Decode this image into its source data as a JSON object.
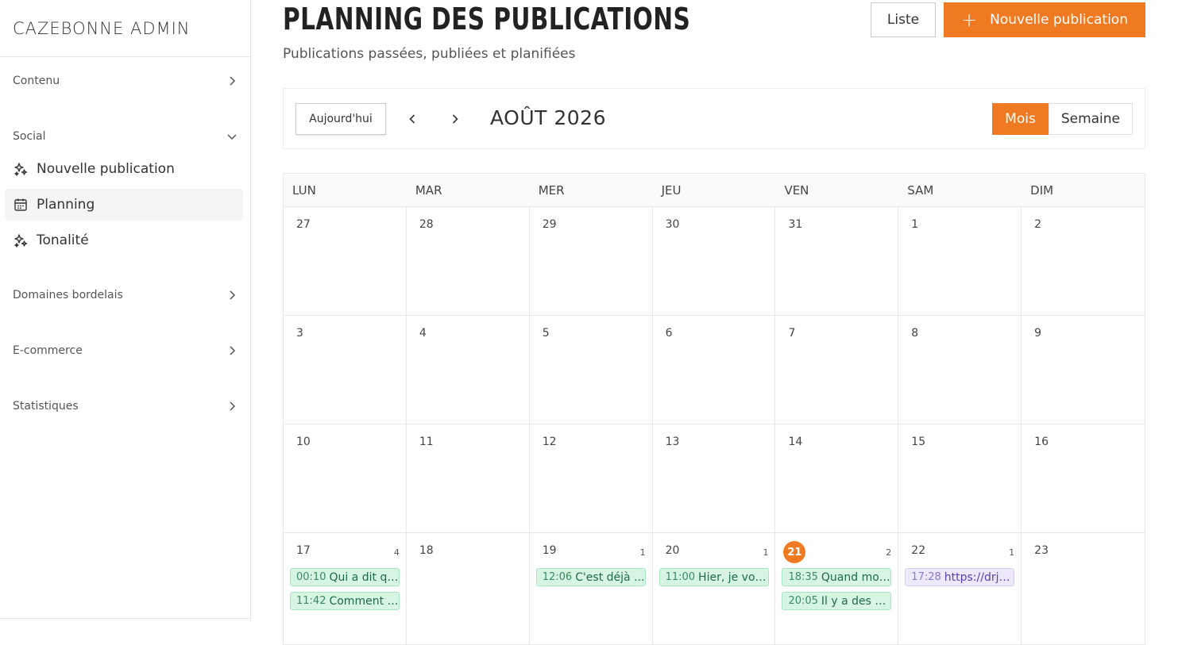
{
  "sidebar": {
    "brand": "CAZEBONNE ADMIN",
    "sections": {
      "contenu": "Contenu",
      "social": "Social",
      "domaines": "Domaines bordelais",
      "ecommerce": "E-commerce",
      "statistiques": "Statistiques"
    },
    "social_items": [
      {
        "label": "Nouvelle publication",
        "icon": "sparkles-icon"
      },
      {
        "label": "Planning",
        "icon": "calendar-icon",
        "active": true
      },
      {
        "label": "Tonalité",
        "icon": "sparkles-icon"
      }
    ]
  },
  "header": {
    "title": "PLANNING DES PUBLICATIONS",
    "subtitle": "Publications passées, publiées et planifiées",
    "list_button": "Liste",
    "new_button": "Nouvelle publication"
  },
  "toolbar": {
    "today_label": "Aujourd'hui",
    "month_label": "AOÛT 2026",
    "view_month": "Mois",
    "view_week": "Semaine"
  },
  "calendar": {
    "weekdays": [
      "LUN",
      "MAR",
      "MER",
      "JEU",
      "VEN",
      "SAM",
      "DIM"
    ],
    "weeks": [
      [
        "27",
        "28",
        "29",
        "30",
        "31",
        "1",
        "2"
      ],
      [
        "3",
        "4",
        "5",
        "6",
        "7",
        "8",
        "9"
      ],
      [
        "10",
        "11",
        "12",
        "13",
        "14",
        "15",
        "16"
      ],
      [
        "17",
        "18",
        "19",
        "20",
        "21",
        "22",
        "23"
      ]
    ],
    "last_week": {
      "counts": [
        "4",
        "",
        "1",
        "1",
        "2",
        "1",
        ""
      ],
      "today_index": 4,
      "events": [
        [
          {
            "time": "00:10",
            "title": "Qui a dit qu...",
            "color": "green"
          },
          {
            "time": "11:42",
            "title": "Comment c...",
            "color": "green"
          }
        ],
        [],
        [
          {
            "time": "12:06",
            "title": "C'est déjà ...",
            "color": "green"
          }
        ],
        [
          {
            "time": "11:00",
            "title": "Hier, je vous...",
            "color": "green"
          }
        ],
        [
          {
            "time": "18:35",
            "title": "Quand mon...",
            "color": "green"
          },
          {
            "time": "20:05",
            "title": "Il y a des pl...",
            "color": "green"
          }
        ],
        [
          {
            "time": "17:28",
            "title": "https://drjol...",
            "color": "purple"
          }
        ],
        []
      ]
    }
  },
  "colors": {
    "accent": "#f07a21"
  }
}
